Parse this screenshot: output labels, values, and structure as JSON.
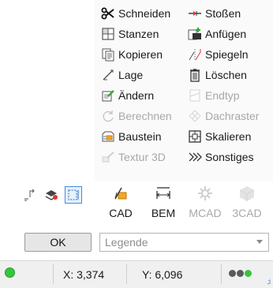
{
  "menu": {
    "left": [
      {
        "label": "Schneiden",
        "icon": "scissors-icon",
        "enabled": true
      },
      {
        "label": "Stanzen",
        "icon": "punch-icon",
        "enabled": true
      },
      {
        "label": "Kopieren",
        "icon": "copy-icon",
        "enabled": true
      },
      {
        "label": "Lage",
        "icon": "position-icon",
        "enabled": true
      },
      {
        "label": "Ändern",
        "icon": "modify-icon",
        "enabled": true
      },
      {
        "label": "Berechnen",
        "icon": "calculate-icon",
        "enabled": false
      },
      {
        "label": "Baustein",
        "icon": "block-icon",
        "enabled": true
      },
      {
        "label": "Textur 3D",
        "icon": "texture-3d-icon",
        "enabled": false
      }
    ],
    "right": [
      {
        "label": "Stoßen",
        "icon": "join-icon",
        "enabled": true
      },
      {
        "label": "Anfügen",
        "icon": "append-icon",
        "enabled": true
      },
      {
        "label": "Spiegeln",
        "icon": "mirror-icon",
        "enabled": true
      },
      {
        "label": "Löschen",
        "icon": "trash-icon",
        "enabled": true
      },
      {
        "label": "Endtyp",
        "icon": "end-type-icon",
        "enabled": false
      },
      {
        "label": "Dachraster",
        "icon": "roof-grid-icon",
        "enabled": false
      },
      {
        "label": "Skalieren",
        "icon": "scale-icon",
        "enabled": true
      },
      {
        "label": "Sonstiges",
        "icon": "chevrons-right-icon",
        "enabled": true
      }
    ]
  },
  "toolbar": {
    "small_icons": [
      "snap-icon",
      "layers-icon",
      "selection-icon"
    ],
    "big_buttons": [
      {
        "label": "CAD",
        "icon": "cad-icon",
        "enabled": true
      },
      {
        "label": "BEM",
        "icon": "dimension-icon",
        "enabled": true
      },
      {
        "label": "MCAD",
        "icon": "mcad-icon",
        "enabled": false
      },
      {
        "label": "3CAD",
        "icon": "3cad-icon",
        "enabled": false
      }
    ]
  },
  "ok_label": "OK",
  "legend_value": "Legende",
  "status": {
    "x": "X: 3,374",
    "y": "Y: 6,096"
  },
  "colors": {
    "status_green": "#35c63e",
    "accent_blue": "#3c8ee4",
    "dot_gray": "#6a6a6a"
  }
}
